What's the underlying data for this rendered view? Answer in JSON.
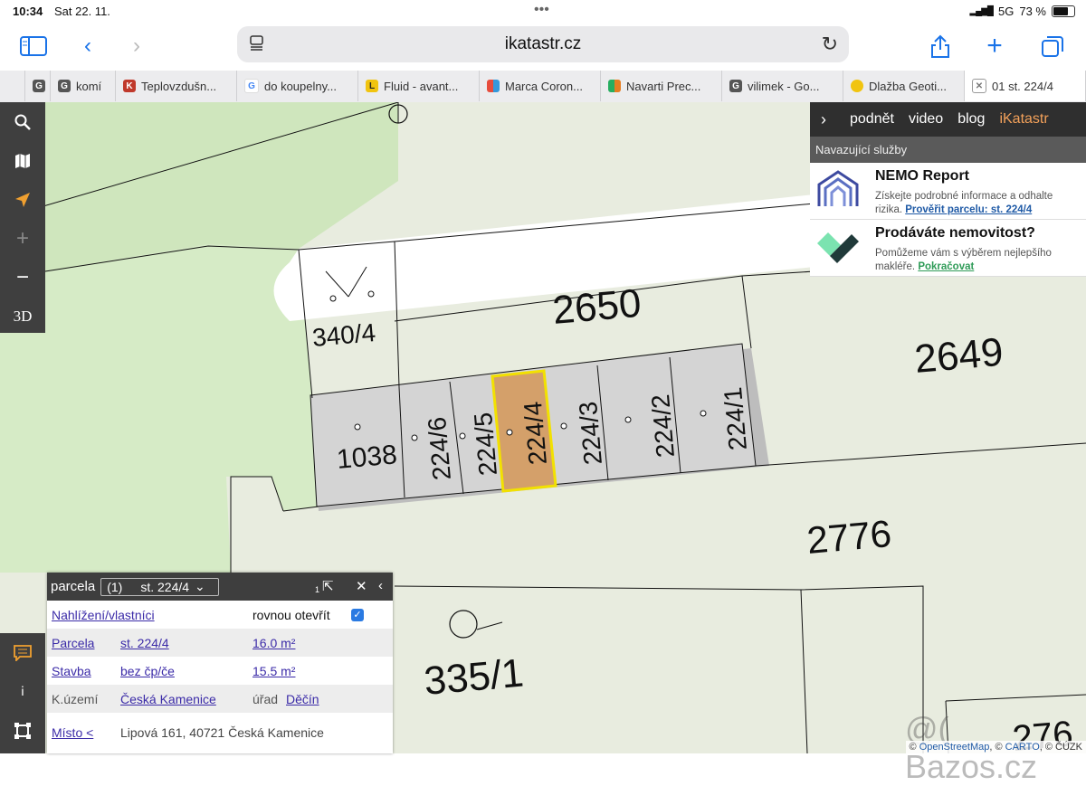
{
  "status": {
    "time": "10:34",
    "date": "Sat 22. 11.",
    "network": "5G",
    "battery": "73 %"
  },
  "browser": {
    "url": "ikatastr.cz",
    "tabs": [
      {
        "label": "G",
        "fav": "G",
        "color": "#555"
      },
      {
        "label": "komí",
        "fav": "G",
        "color": "#555"
      },
      {
        "label": "Teplovzdušn...",
        "fav": "K",
        "color": "#c0392b"
      },
      {
        "label": "do koupelny...",
        "fav": "G",
        "color": "#4285f4"
      },
      {
        "label": "Fluid - avant...",
        "fav": "L",
        "color": "#222"
      },
      {
        "label": "Marca Coron...",
        "fav": "■",
        "color": "#e74c3c"
      },
      {
        "label": "Navarti Prec...",
        "fav": "■",
        "color": "#27ae60"
      },
      {
        "label": "vilimek - Go...",
        "fav": "G",
        "color": "#555"
      },
      {
        "label": "Dlažba Geoti...",
        "fav": "●",
        "color": "#f1c40f"
      },
      {
        "label": "01 st. 224/4",
        "fav": "x",
        "color": "#777",
        "active": true
      }
    ]
  },
  "tools": {
    "zoom_in": "+",
    "zoom_out": "−",
    "mode3d": "3D"
  },
  "panel": {
    "nav": [
      "podnět",
      "video",
      "blog",
      "iKatastr"
    ],
    "subtitle": "Navazující služby",
    "services": [
      {
        "title": "NEMO Report",
        "desc": "Získejte podrobné informace a odhalte rizika.",
        "link": "Prověřit parcelu: st. 224/4"
      },
      {
        "title": "Prodáváte nemovitost?",
        "desc": "Pomůžeme vám s výběrem nejlepšího makléře.",
        "link": "Pokračovat"
      }
    ]
  },
  "map": {
    "labels": [
      "2650",
      "2649",
      "340/4",
      "1038",
      "224/6",
      "224/5",
      "224/4",
      "224/3",
      "224/2",
      "224/1",
      "2776",
      "335/1",
      "276"
    ],
    "watermark": "@( Bazos.cz"
  },
  "info": {
    "title": "parcela",
    "count": "(1)",
    "selected": "st. 224/4",
    "badge": "1",
    "rows": {
      "r1": {
        "label": "Nahlížení/vlastníci",
        "right": "rovnou otevřít"
      },
      "r2": {
        "label": "Parcela",
        "value": "st. 224/4",
        "area": "16.0 m²"
      },
      "r3": {
        "label": "Stavba",
        "value": "bez čp/če",
        "area": "15.5 m²"
      },
      "r4": {
        "label": "K.území",
        "value": "Česká Kamenice",
        "office_label": "úřad",
        "office": "Děčín"
      },
      "r5": {
        "label": "Místo <",
        "value": "Lipová 161, 40721 Česká Kamenice"
      }
    }
  },
  "attribution": {
    "prefix": "©",
    "osm": "OpenStreetMap",
    "carto": "CARTO",
    "cuzk": "ČÚZK",
    "sep1": ", ©",
    "sep2": ", ©"
  }
}
